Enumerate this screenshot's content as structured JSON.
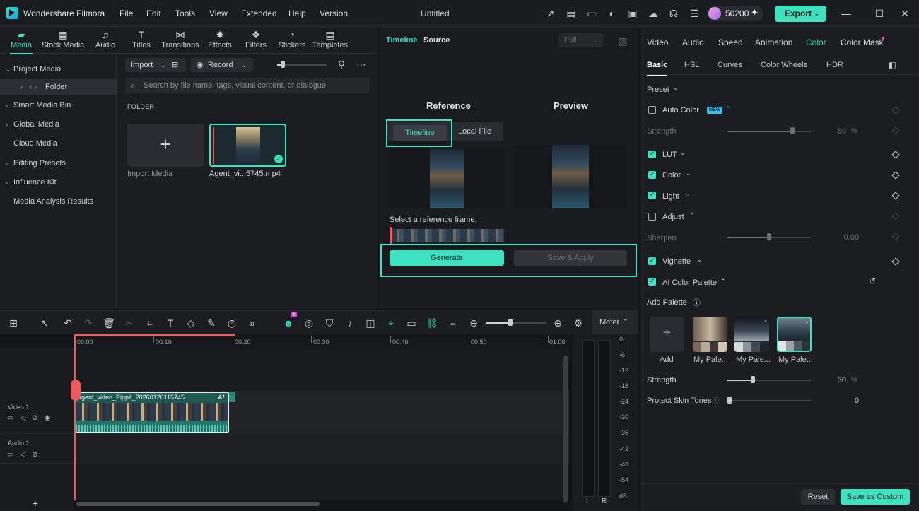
{
  "app": {
    "name": "Wondershare Filmora",
    "menu": [
      "File",
      "Edit",
      "Tools",
      "View",
      "Extended",
      "Help",
      "Version"
    ],
    "title": "Untitled",
    "credits": "50200",
    "export_label": "Export"
  },
  "library": {
    "tabs": [
      {
        "label": "Media",
        "icon": "media-icon",
        "active": true
      },
      {
        "label": "Stock Media",
        "icon": "stock-media-icon"
      },
      {
        "label": "Audio",
        "icon": "music-note-icon"
      },
      {
        "label": "Titles",
        "icon": "text-icon"
      },
      {
        "label": "Transitions",
        "icon": "transition-icon"
      },
      {
        "label": "Effects",
        "icon": "effects-icon"
      },
      {
        "label": "Filters",
        "icon": "filters-icon"
      },
      {
        "label": "Stickers",
        "icon": "stickers-icon"
      },
      {
        "label": "Templates",
        "icon": "templates-icon"
      }
    ],
    "sidebar": [
      "Project Media",
      "Folder",
      "Smart Media Bin",
      "Global Media",
      "Cloud Media",
      "Editing Presets",
      "Influence Kit",
      "Media Analysis Results"
    ],
    "import_label": "Import",
    "record_label": "Record",
    "search_placeholder": "Search by file name, tags, visual content, or dialogue",
    "folder_heading": "FOLDER",
    "import_media_label": "Import Media",
    "clip_label": "Agent_vi...5745.mp4"
  },
  "player": {
    "tab_timeline": "Timeline",
    "tab_source": "Source",
    "quality": "Full",
    "reference_title": "Reference",
    "preview_title": "Preview",
    "toggle_timeline": "Timeline",
    "toggle_local": "Local File",
    "select_frame_label": "Select a reference frame:",
    "generate_label": "Generate",
    "save_apply_label": "Save & Apply"
  },
  "color_panel": {
    "tabs": [
      "Video",
      "Audio",
      "Speed",
      "Animation",
      "Color",
      "Color Mask"
    ],
    "active_tab": "Color",
    "subtabs": [
      "Basic",
      "HSL",
      "Curves",
      "Color Wheels",
      "HDR"
    ],
    "preset_label": "Preset",
    "auto_color_label": "Auto Color",
    "new_badge": "NEW",
    "strength_label": "Strength",
    "strength_value": "80",
    "strength_unit": "%",
    "lut_label": "LUT",
    "color_label": "Color",
    "light_label": "Light",
    "adjust_label": "Adjust",
    "sharpen_label": "Sharpen",
    "sharpen_value": "0.00",
    "vignette_label": "Vignette",
    "ai_palette_label": "AI Color Palette",
    "add_palette_label": "Add Palette",
    "palette_items": [
      "Add",
      "My Pale...",
      "My Pale...",
      "My Pale..."
    ],
    "palette_strength_label": "Strength",
    "palette_strength_value": "30",
    "palette_strength_unit": "%",
    "skin_label": "Protect Skin Tones",
    "skin_value": "0",
    "reset_label": "Reset",
    "save_custom_label": "Save as Custom"
  },
  "timeline": {
    "meter_label": "Meter",
    "ticks": [
      "00:00",
      "00:10",
      "00:20",
      "00:30",
      "00:40",
      "00:50",
      "01:00"
    ],
    "video_track": "Video 1",
    "audio_track": "Audio 1",
    "clip_name": "Agent_video_Pippit_20260126115745",
    "clip_ai": "AI",
    "db_scale": [
      "0",
      "-6",
      "-12",
      "-18",
      "-24",
      "-30",
      "-36",
      "-42",
      "-48",
      "-54",
      "dB"
    ],
    "left_label": "L",
    "right_label": "R"
  },
  "colors": {
    "accent": "#3ee2c0",
    "playhead": "#ef5b5b"
  }
}
